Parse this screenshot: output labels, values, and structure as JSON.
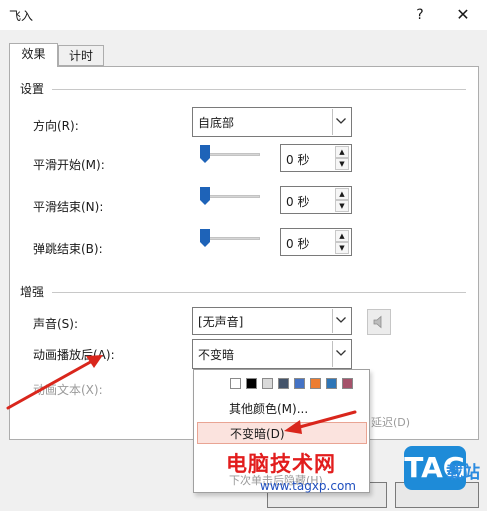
{
  "window": {
    "title": "飞入",
    "help": "?",
    "close": "✕"
  },
  "tabs": [
    {
      "label": "效果"
    },
    {
      "label": "计时"
    }
  ],
  "settings": {
    "heading": "设置",
    "direction": {
      "label": "方向(R):",
      "value": "自底部"
    },
    "smooth_start": {
      "label": "平滑开始(M):",
      "value": "0 秒",
      "slider": 0
    },
    "smooth_end": {
      "label": "平滑结束(N):",
      "value": "0 秒",
      "slider": 0
    },
    "bounce_end": {
      "label": "弹跳结束(B):",
      "value": "0 秒",
      "slider": 0
    }
  },
  "enhance": {
    "heading": "增强",
    "sound": {
      "label": "声音(S):",
      "value": "[无声音]"
    },
    "after_animation": {
      "label": "动画播放后(A):",
      "value": "不变暗"
    },
    "animate_text": {
      "label": "动画文本(X):"
    }
  },
  "dropdown": {
    "swatches": [
      "#ffffff",
      "#000000",
      "#d9d9d9",
      "#44546a",
      "#4472c4",
      "#ed7d31",
      "#2e75b6",
      "#a5526a"
    ],
    "more_colors": "其他颜色(M)...",
    "dont_dim": "不变暗(D)",
    "hide_next": "下次单击后隐藏(H)"
  },
  "stray_text": {
    "delay": "延迟(D)"
  },
  "watermark": {
    "brand": "电脑技术网",
    "url": "www.tagxp.com",
    "logo": "TAG",
    "site": "载站"
  }
}
